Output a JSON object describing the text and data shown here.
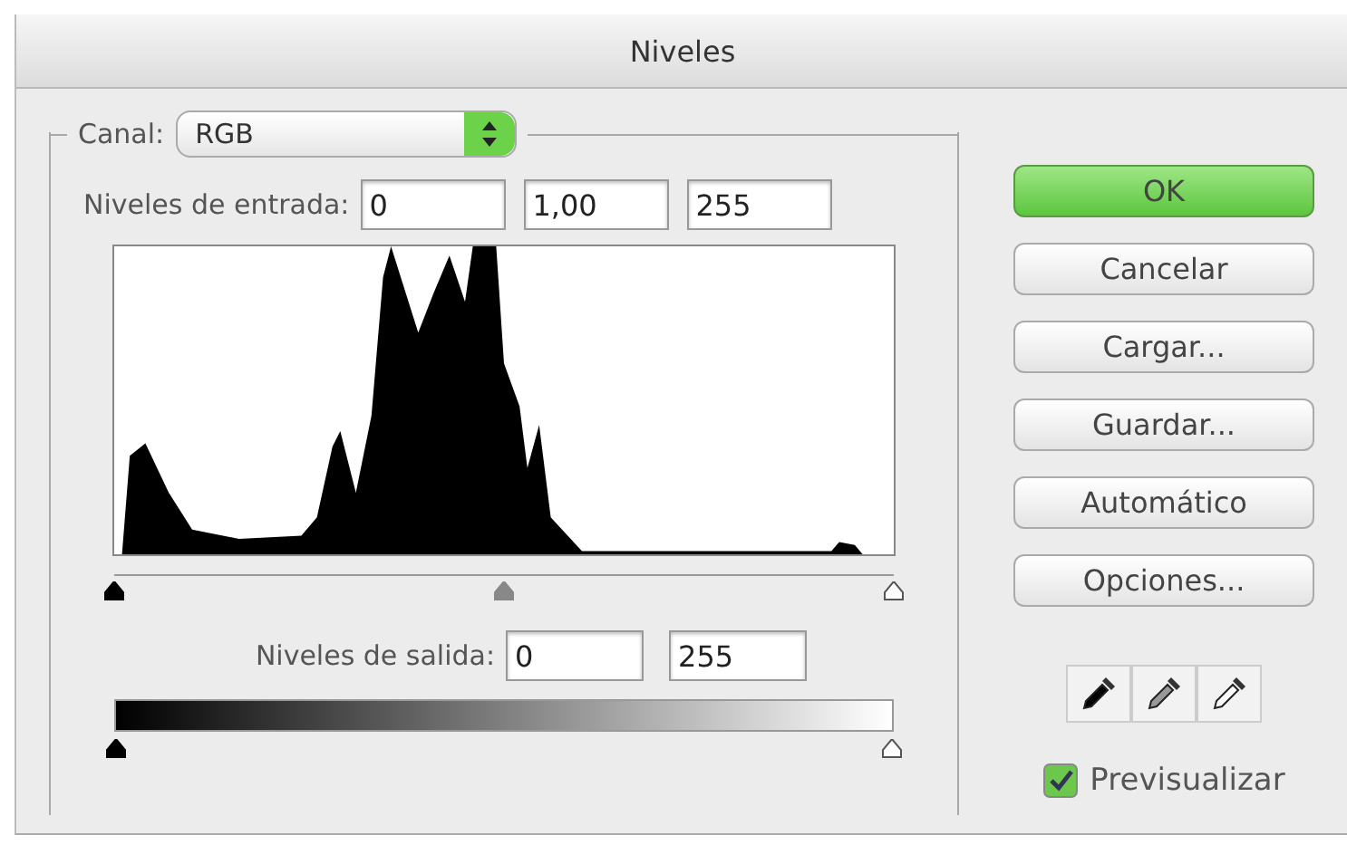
{
  "window": {
    "title": "Niveles"
  },
  "channel": {
    "label": "Canal:",
    "value": "RGB"
  },
  "input_levels": {
    "label": "Niveles de entrada:",
    "values": [
      "0",
      "1,00",
      "255"
    ],
    "handles": [
      {
        "kind": "black",
        "level": 0
      },
      {
        "kind": "gray",
        "level": 0.5
      },
      {
        "kind": "white",
        "level": 1
      }
    ]
  },
  "output_levels": {
    "label": "Niveles de salida:",
    "values": [
      "0",
      "255"
    ],
    "handles": [
      {
        "kind": "black",
        "level": 0
      },
      {
        "kind": "white",
        "level": 1
      }
    ]
  },
  "buttons": [
    {
      "label": "OK",
      "default": true
    },
    {
      "label": "Cancelar",
      "default": false
    },
    {
      "label": "Cargar...",
      "default": false
    },
    {
      "label": "Guardar...",
      "default": false
    },
    {
      "label": "Automático",
      "default": false
    },
    {
      "label": "Opciones...",
      "default": false
    }
  ],
  "eyedroppers": [
    {
      "kind": "black"
    },
    {
      "kind": "gray"
    },
    {
      "kind": "white"
    }
  ],
  "preview": {
    "label": "Previsualizar",
    "checked": true
  }
}
